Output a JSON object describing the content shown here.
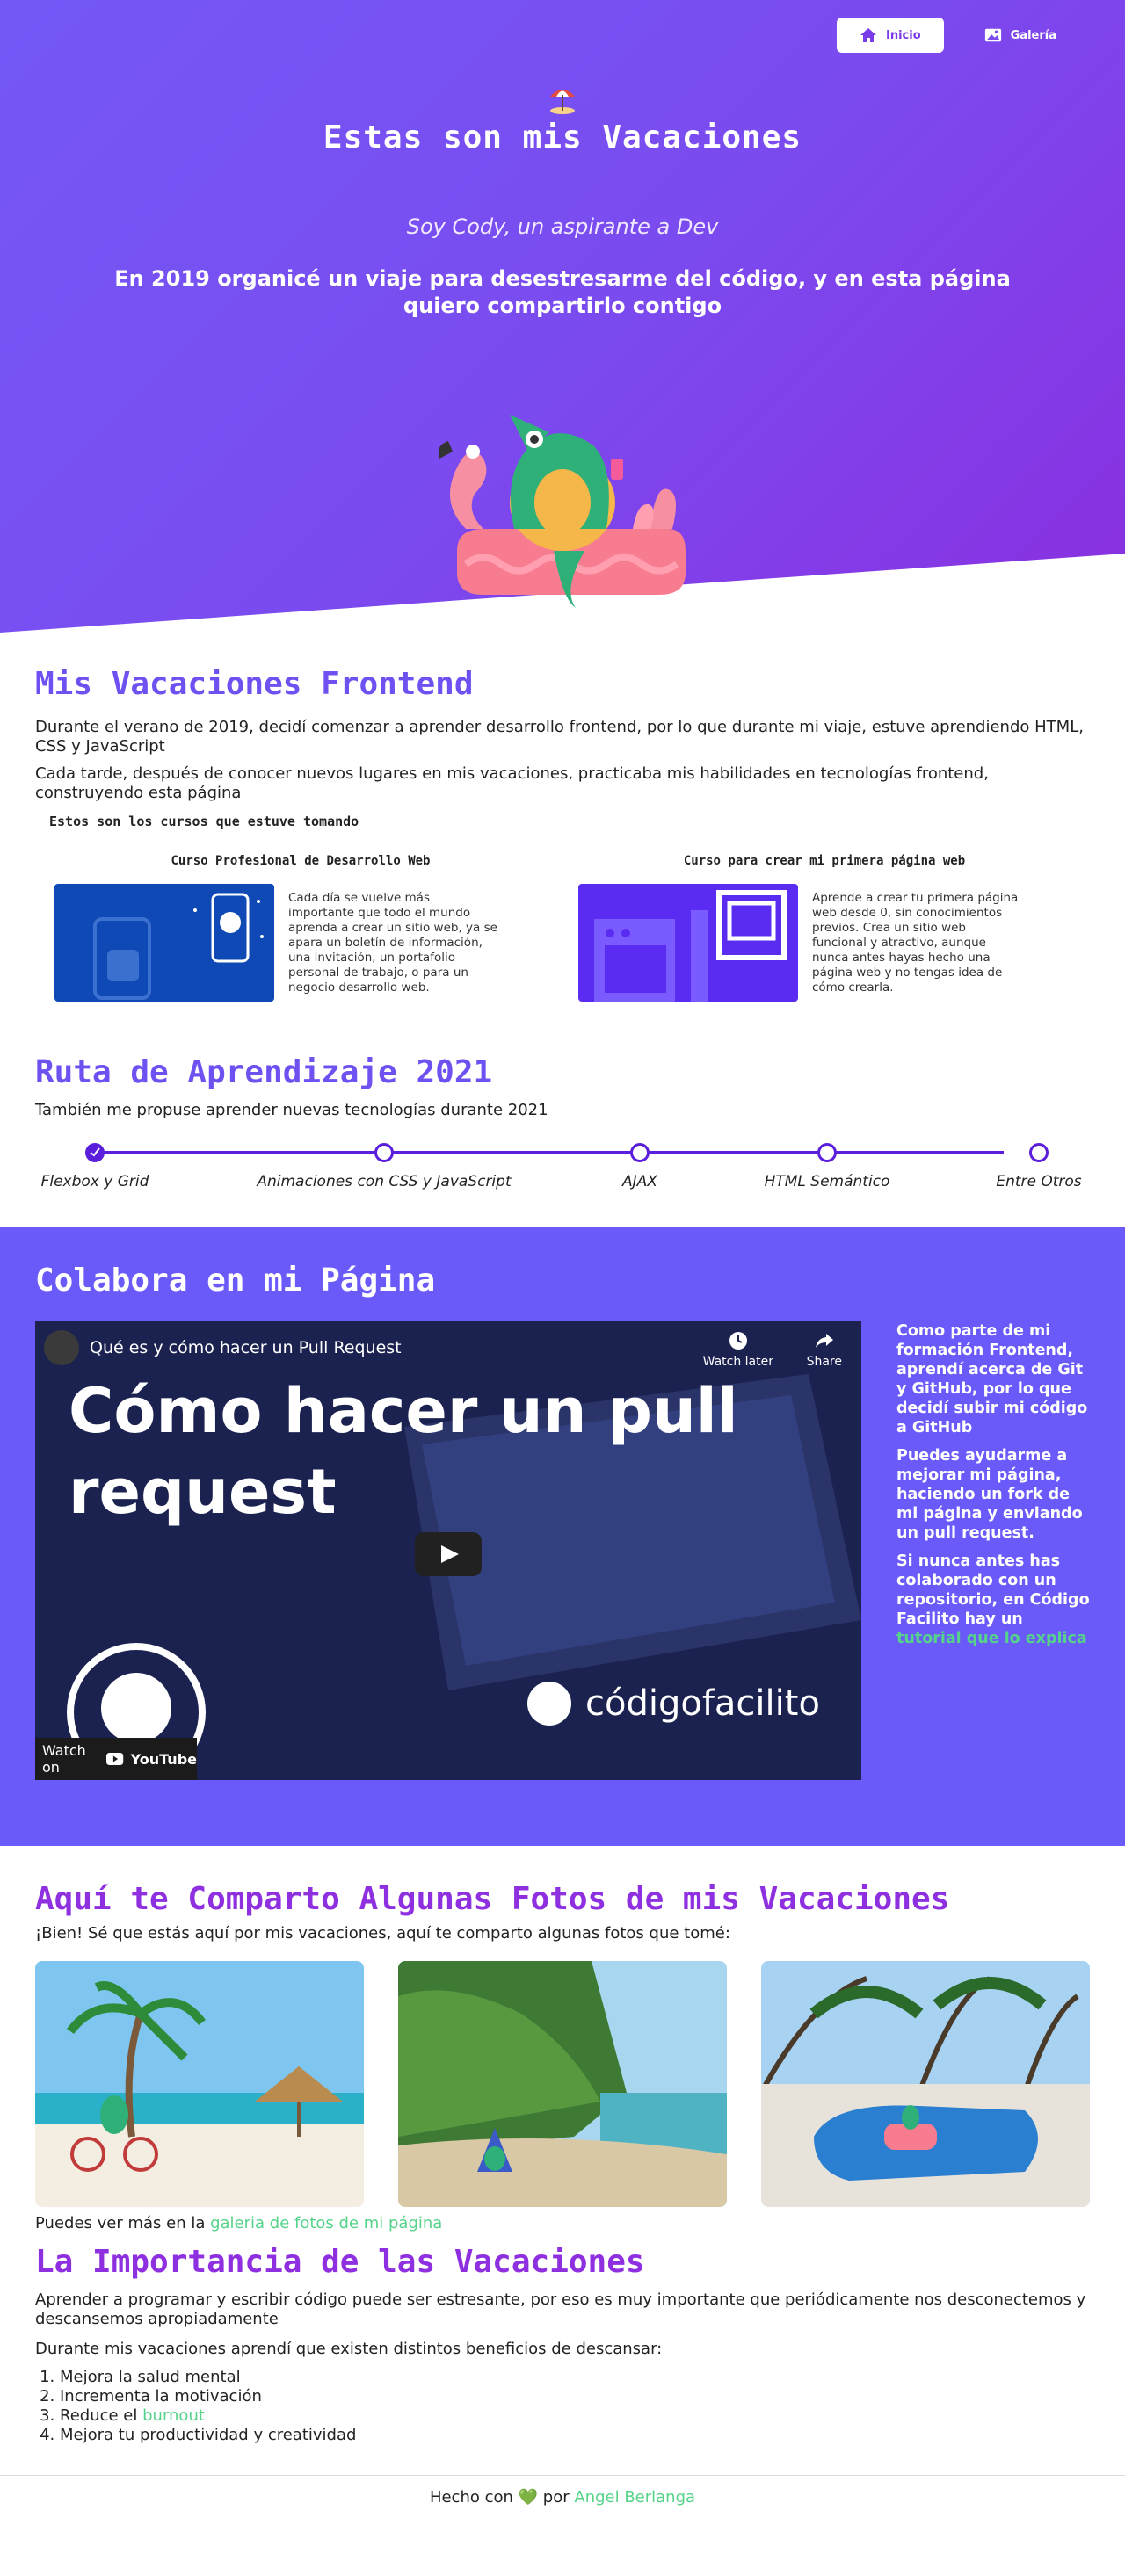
{
  "nav": {
    "home_label": "Inicio",
    "gallery_label": "Galería"
  },
  "hero": {
    "title": "Estas son mis Vacaciones",
    "subtitle": "Soy Cody, un aspirante a Dev",
    "lead": "En 2019 organicé un viaje para desestresarme del código, y en esta página quiero compartirlo contigo"
  },
  "frontend": {
    "title": "Mis Vacaciones Frontend",
    "p1": "Durante el verano de 2019, decidí comenzar a aprender desarrollo frontend, por lo que durante mi viaje, estuve aprendiendo HTML, CSS y JavaScript",
    "p2": "Cada tarde, después de conocer nuevos lugares en mis vacaciones, practicaba mis habilidades en tecnologías frontend, construyendo esta página",
    "courses_heading": "Estos son los cursos que estuve tomando",
    "courses": [
      {
        "title": "Curso Profesional de Desarrollo Web",
        "description": "Cada día se vuelve más importante que todo el mundo aprenda a crear un sitio web, ya se apara un boletín de información, una invitación, un portafolio personal de trabajo, o para un negocio desarrollo web."
      },
      {
        "title": "Curso para crear mi primera página web",
        "description": "Aprende a crear tu primera página web desde 0, sin conocimientos previos. Crea un sitio web funcional y atractivo, aunque nunca antes hayas hecho una página web y no tengas idea de cómo crearla."
      }
    ]
  },
  "route": {
    "title": "Ruta de Aprendizaje 2021",
    "intro": "También me propuse aprender nuevas tecnologías durante 2021",
    "steps": [
      {
        "label": "Flexbox y Grid",
        "done": true
      },
      {
        "label": "Animaciones con CSS y JavaScript",
        "done": false
      },
      {
        "label": "AJAX",
        "done": false
      },
      {
        "label": "HTML Semántico",
        "done": false
      },
      {
        "label": "Entre Otros",
        "done": false
      }
    ]
  },
  "collab": {
    "title": "Colabora en mi Página",
    "video": {
      "channel_title": "Qué es y cómo hacer un Pull Request",
      "watch_later": "Watch later",
      "share": "Share",
      "big_line1": "Cómo hacer un pull",
      "big_line2": "request",
      "brand": "códigofacilito",
      "watch_on": "Watch on",
      "youtube": "YouTube"
    },
    "p1": "Como parte de mi formación Frontend, aprendí acerca de Git y GitHub, por lo que decidí subir mi código a GitHub",
    "p2": "Puedes ayudarme a mejorar mi página, haciendo un fork de mi página y enviando un pull request.",
    "p3_prefix": "Si nunca antes has colaborado con un repositorio, en Código Facilito hay un ",
    "p3_link": "tutorial que lo explica"
  },
  "photos": {
    "title": "Aquí te Comparto Algunas Fotos de mis Vacaciones",
    "intro": "¡Bien! Sé que estás aquí por mis vacaciones, aquí te comparto algunas fotos que tomé:",
    "more_prefix": "Puedes ver más en la ",
    "more_link": "galeria de fotos de mi página"
  },
  "importance": {
    "title": "La Importancia de las Vacaciones",
    "p1": "Aprender a programar y escribir código puede ser estresante, por eso es muy importante que periódicamente nos desconectemos y descansemos apropiadamente",
    "p2": "Durante mis vacaciones aprendí que existen distintos beneficios de descansar:",
    "items": [
      "Mejora la salud mental",
      "Incrementa la motivación",
      "Mejora tu productividad y creatividad"
    ],
    "item3_prefix": "Reduce el ",
    "item3_link": "burnout"
  },
  "footer": {
    "prefix": "Hecho con",
    "heart": "💚",
    "by": "por",
    "author": "Angel Berlanga"
  },
  "colors": {
    "purple": "#6f51f2",
    "magenta": "#8e2fe0",
    "collab_bg": "#6a5af9",
    "link_green": "#56d38a",
    "timeline": "#5b1fdc"
  }
}
